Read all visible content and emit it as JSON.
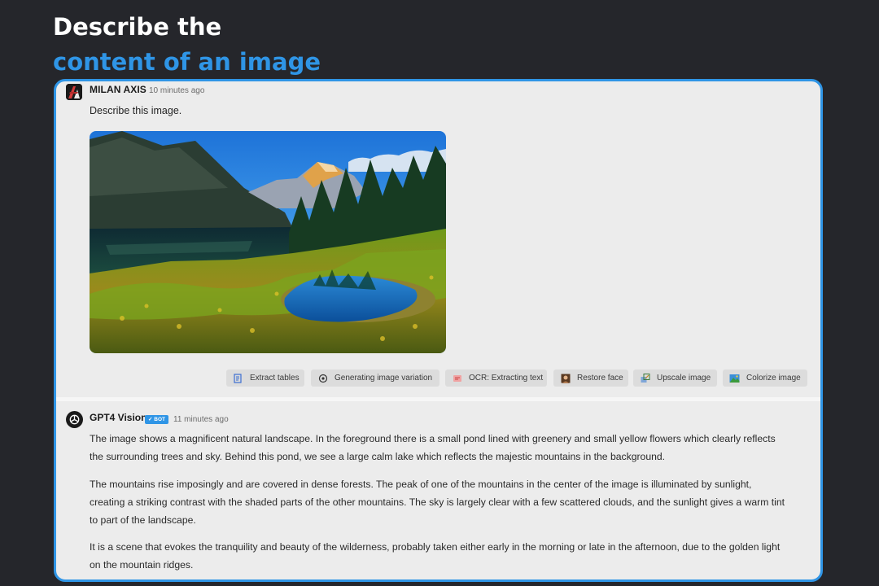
{
  "headline": {
    "line1": "Describe the",
    "line2": "content of an image"
  },
  "user_message": {
    "author": "MILAN AXIS",
    "time": "10 minutes ago",
    "text": "Describe this image.",
    "avatar_icon": "user-avatar-icon",
    "image_subject": "mountain lake landscape photo"
  },
  "actions": [
    {
      "label": "Extract tables",
      "icon": "table-extract-icon"
    },
    {
      "label": "Generating image variation",
      "icon": "openai-icon"
    },
    {
      "label": "OCR: Extracting text",
      "icon": "ocr-icon"
    },
    {
      "label": "Restore face",
      "icon": "portrait-icon"
    },
    {
      "label": "Upscale image",
      "icon": "upscale-icon"
    },
    {
      "label": "Colorize image",
      "icon": "landscape-icon"
    }
  ],
  "bot_message": {
    "author": "GPT4 Vision",
    "badge": "✓ BOT",
    "time": "11 minutes ago",
    "paragraphs": [
      "The image shows a magnificent natural landscape. In the foreground there is a small pond lined with greenery and small yellow flowers which clearly reflects the surrounding trees and sky. Behind this pond, we see a large calm lake which reflects the majestic mountains in the background.",
      "The mountains rise imposingly and are covered in dense forests. The peak of one of the mountains in the center of the image is illuminated by sunlight, creating a striking contrast with the shaded parts of the other mountains. The sky is largely clear with a few scattered clouds, and the sunlight gives a warm tint to part of the landscape.",
      "It is a scene that evokes the tranquility and beauty of the wilderness, probably taken either early in the morning or late in the afternoon, due to the golden light on the mountain ridges."
    ]
  },
  "colors": {
    "accent": "#2f95e6",
    "background": "#25262b",
    "panel": "#ececec"
  }
}
